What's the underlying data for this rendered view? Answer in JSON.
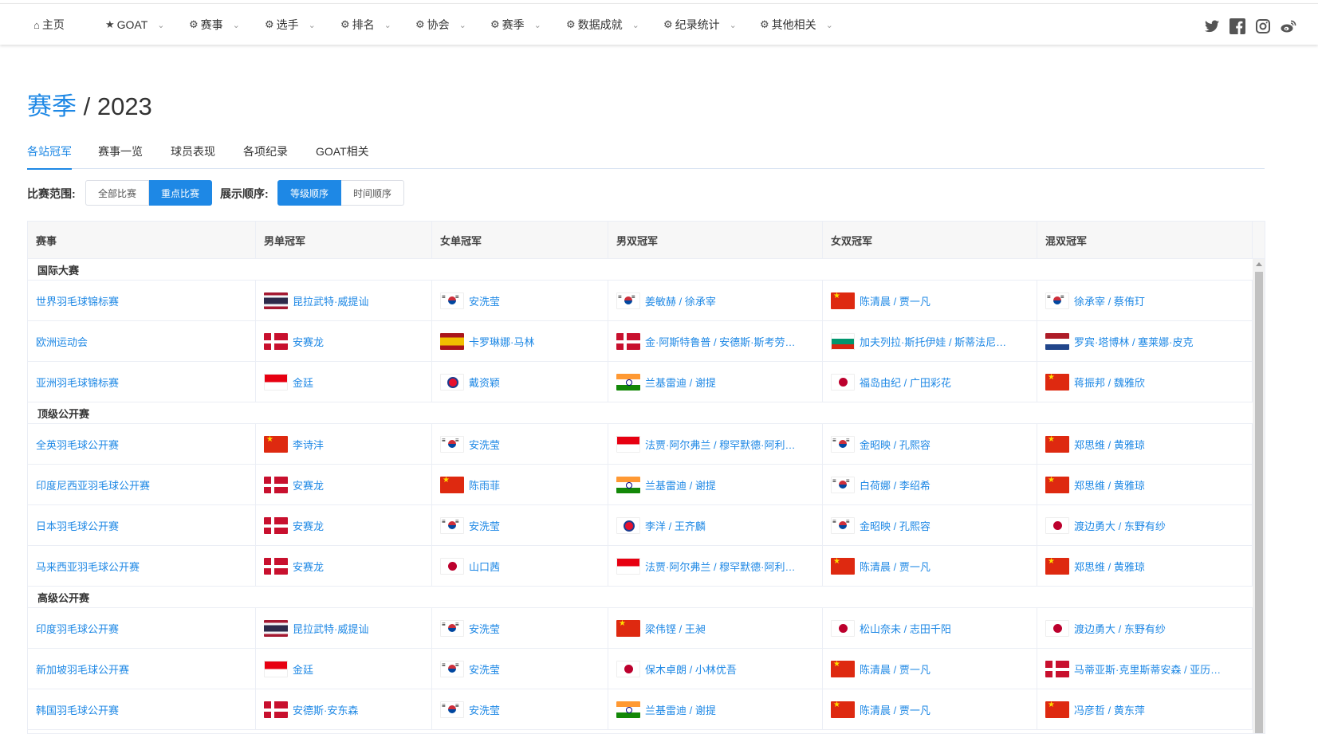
{
  "nav": {
    "items": [
      {
        "label": "主页",
        "icon": "home-icon",
        "glyph": "⌂",
        "chevron": false
      },
      {
        "label": "GOAT",
        "icon": "star-icon",
        "glyph": "★",
        "chevron": true
      },
      {
        "label": "赛事",
        "icon": "gear-icon",
        "glyph": "⚙",
        "chevron": true
      },
      {
        "label": "选手",
        "icon": "gear-icon",
        "glyph": "⚙",
        "chevron": true
      },
      {
        "label": "排名",
        "icon": "gear-icon",
        "glyph": "⚙",
        "chevron": true
      },
      {
        "label": "协会",
        "icon": "gear-icon",
        "glyph": "⚙",
        "chevron": true
      },
      {
        "label": "赛季",
        "icon": "gear-icon",
        "glyph": "⚙",
        "chevron": true
      },
      {
        "label": "数据成就",
        "icon": "gear-icon",
        "glyph": "⚙",
        "chevron": true
      },
      {
        "label": "纪录统计",
        "icon": "gear-icon",
        "glyph": "⚙",
        "chevron": true
      },
      {
        "label": "其他相关",
        "icon": "gear-icon",
        "glyph": "⚙",
        "chevron": true
      }
    ],
    "social": [
      "twitter-icon",
      "facebook-icon",
      "instagram-icon",
      "weibo-icon"
    ]
  },
  "page": {
    "breadcrumb_link": "赛季",
    "title_rest": " / 2023"
  },
  "tabs": {
    "items": [
      "各站冠军",
      "赛事一览",
      "球员表现",
      "各项纪录",
      "GOAT相关"
    ],
    "active": "各站冠军"
  },
  "filters": {
    "range_label": "比赛范围:",
    "range_options": [
      "全部比赛",
      "重点比赛"
    ],
    "range_selected": "重点比赛",
    "order_label": "展示顺序:",
    "order_options": [
      "等级顺序",
      "时间顺序"
    ],
    "order_selected": "等级顺序"
  },
  "table": {
    "columns": [
      "赛事",
      "男单冠军",
      "女单冠军",
      "男双冠军",
      "女双冠军",
      "混双冠军"
    ],
    "groups": [
      {
        "name": "国际大赛",
        "rows": [
          {
            "event": "世界羽毛球锦标赛",
            "cells": [
              {
                "flag": "th",
                "name": "昆拉武特·威提讪"
              },
              {
                "flag": "kr",
                "name": "安洗莹"
              },
              {
                "flag": "kr",
                "name": "姜敏赫 / 徐承宰"
              },
              {
                "flag": "cn",
                "name": "陈清晨 / 贾一凡"
              },
              {
                "flag": "kr",
                "name": "徐承宰 / 蔡侑玎"
              }
            ]
          },
          {
            "event": "欧洲运动会",
            "cells": [
              {
                "flag": "dk",
                "name": "安赛龙"
              },
              {
                "flag": "es",
                "name": "卡罗琳娜·马林"
              },
              {
                "flag": "dk",
                "name": "金·阿斯特鲁普 / 安德斯·斯考劳…"
              },
              {
                "flag": "bg",
                "name": "加夫列拉·斯托伊娃 / 斯蒂法尼…"
              },
              {
                "flag": "nl",
                "name": "罗宾·塔博林 / 塞莱娜·皮克"
              }
            ]
          },
          {
            "event": "亚洲羽毛球锦标赛",
            "cells": [
              {
                "flag": "id",
                "name": "金廷"
              },
              {
                "flag": "tpe",
                "name": "戴资颖"
              },
              {
                "flag": "in",
                "name": "兰基雷迪 / 谢提"
              },
              {
                "flag": "jp",
                "name": "福岛由纪 / 广田彩花"
              },
              {
                "flag": "cn",
                "name": "蒋振邦 / 魏雅欣"
              }
            ]
          }
        ]
      },
      {
        "name": "顶级公开赛",
        "rows": [
          {
            "event": "全英羽毛球公开赛",
            "cells": [
              {
                "flag": "cn",
                "name": "李诗沣"
              },
              {
                "flag": "kr",
                "name": "安洗莹"
              },
              {
                "flag": "id",
                "name": "法贾·阿尔弗兰 / 穆罕默德·阿利…"
              },
              {
                "flag": "kr",
                "name": "金昭映 / 孔熙容"
              },
              {
                "flag": "cn",
                "name": "郑思维 / 黄雅琼"
              }
            ]
          },
          {
            "event": "印度尼西亚羽毛球公开赛",
            "cells": [
              {
                "flag": "dk",
                "name": "安赛龙"
              },
              {
                "flag": "cn",
                "name": "陈雨菲"
              },
              {
                "flag": "in",
                "name": "兰基雷迪 / 谢提"
              },
              {
                "flag": "kr",
                "name": "白荷娜 / 李绍希"
              },
              {
                "flag": "cn",
                "name": "郑思维 / 黄雅琼"
              }
            ]
          },
          {
            "event": "日本羽毛球公开赛",
            "cells": [
              {
                "flag": "dk",
                "name": "安赛龙"
              },
              {
                "flag": "kr",
                "name": "安洗莹"
              },
              {
                "flag": "tpe",
                "name": "李洋 / 王齐麟"
              },
              {
                "flag": "kr",
                "name": "金昭映 / 孔熙容"
              },
              {
                "flag": "jp",
                "name": "渡边勇大 / 东野有纱"
              }
            ]
          },
          {
            "event": "马来西亚羽毛球公开赛",
            "cells": [
              {
                "flag": "dk",
                "name": "安赛龙"
              },
              {
                "flag": "jp",
                "name": "山口茜"
              },
              {
                "flag": "id",
                "name": "法贾·阿尔弗兰 / 穆罕默德·阿利…"
              },
              {
                "flag": "cn",
                "name": "陈清晨 / 贾一凡"
              },
              {
                "flag": "cn",
                "name": "郑思维 / 黄雅琼"
              }
            ]
          }
        ]
      },
      {
        "name": "高级公开赛",
        "rows": [
          {
            "event": "印度羽毛球公开赛",
            "cells": [
              {
                "flag": "th",
                "name": "昆拉武特·威提讪"
              },
              {
                "flag": "kr",
                "name": "安洗莹"
              },
              {
                "flag": "cn",
                "name": "梁伟铿 / 王昶"
              },
              {
                "flag": "jp",
                "name": "松山奈未 / 志田千阳"
              },
              {
                "flag": "jp",
                "name": "渡边勇大 / 东野有纱"
              }
            ]
          },
          {
            "event": "新加坡羽毛球公开赛",
            "cells": [
              {
                "flag": "id",
                "name": "金廷"
              },
              {
                "flag": "kr",
                "name": "安洗莹"
              },
              {
                "flag": "jp",
                "name": "保木卓朗 / 小林优吾"
              },
              {
                "flag": "cn",
                "name": "陈清晨 / 贾一凡"
              },
              {
                "flag": "dk",
                "name": "马蒂亚斯·克里斯蒂安森 / 亚历…"
              }
            ]
          },
          {
            "event": "韩国羽毛球公开赛",
            "cells": [
              {
                "flag": "dk",
                "name": "安德斯·安东森"
              },
              {
                "flag": "kr",
                "name": "安洗莹"
              },
              {
                "flag": "in",
                "name": "兰基雷迪 / 谢提"
              },
              {
                "flag": "cn",
                "name": "陈清晨 / 贾一凡"
              },
              {
                "flag": "cn",
                "name": "冯彦哲 / 黄东萍"
              }
            ]
          }
        ]
      }
    ]
  },
  "colors": {
    "accent": "#1e88e5",
    "header_bg": "#f7f7f7",
    "border": "#ebeef5"
  }
}
